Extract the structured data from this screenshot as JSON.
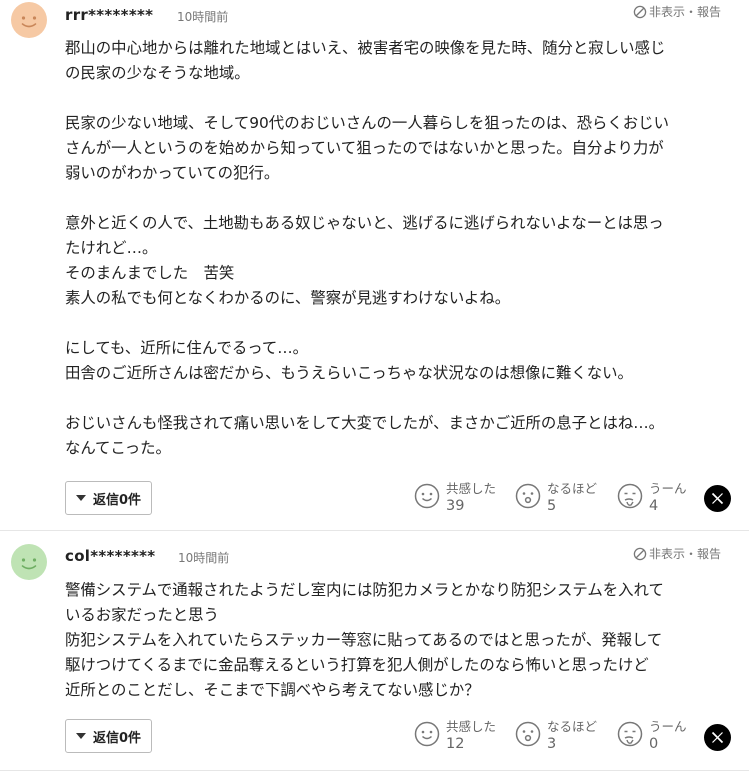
{
  "comments": [
    {
      "username": "rrr********",
      "time": "10時間前",
      "hide_report": "非表示・報告",
      "avatar_color": "#f6c9a4",
      "body": "郡山の中心地からは離れた地域とはいえ、被害者宅の映像を見た時、随分と寂しい感じ\nの民家の少なそうな地域。\n\n民家の少ない地域、そして90代のおじいさんの一人暮らしを狙ったのは、恐らくおじい\nさんが一人というのを始めから知っていて狙ったのではないかと思った。自分より力が\n弱いのがわかっていての犯行。\n\n意外と近くの人で、土地勘もある奴じゃないと、逃げるに逃げられないよなーとは思っ\nたけれど…。\nそのまんまでした　苦笑\n素人の私でも何となくわかるのに、警察が見逃すわけないよね。\n\nにしても、近所に住んでるって…。\n田舎のご近所さんは密だから、もうえらいこっちゃな状況なのは想像に難くない。\n\nおじいさんも怪我されて痛い思いをして大変でしたが、まさかご近所の息子とはね…。\nなんてこった。",
      "reply_label": "返信0件",
      "reactions": [
        {
          "label": "共感した",
          "count": "39",
          "icon": "smile-icon"
        },
        {
          "label": "なるほど",
          "count": "5",
          "icon": "surprise-icon"
        },
        {
          "label": "うーん",
          "count": "4",
          "icon": "hmm-icon"
        }
      ]
    },
    {
      "username": "col********",
      "time": "10時間前",
      "hide_report": "非表示・報告",
      "avatar_color": "#bfe3b4",
      "body": "警備システムで通報されたようだし室内には防犯カメラとかなり防犯システムを入れて\nいるお家だったと思う\n防犯システムを入れていたらステッカー等窓に貼ってあるのではと思ったが、発報して\n駆けつけてくるまでに金品奪えるという打算を犯人側がしたのなら怖いと思ったけど\n近所とのことだし、そこまで下調べやら考えてない感じか？",
      "reply_label": "返信0件",
      "reactions": [
        {
          "label": "共感した",
          "count": "12",
          "icon": "smile-icon"
        },
        {
          "label": "なるほど",
          "count": "3",
          "icon": "surprise-icon"
        },
        {
          "label": "うーん",
          "count": "0",
          "icon": "hmm-icon"
        }
      ]
    }
  ]
}
